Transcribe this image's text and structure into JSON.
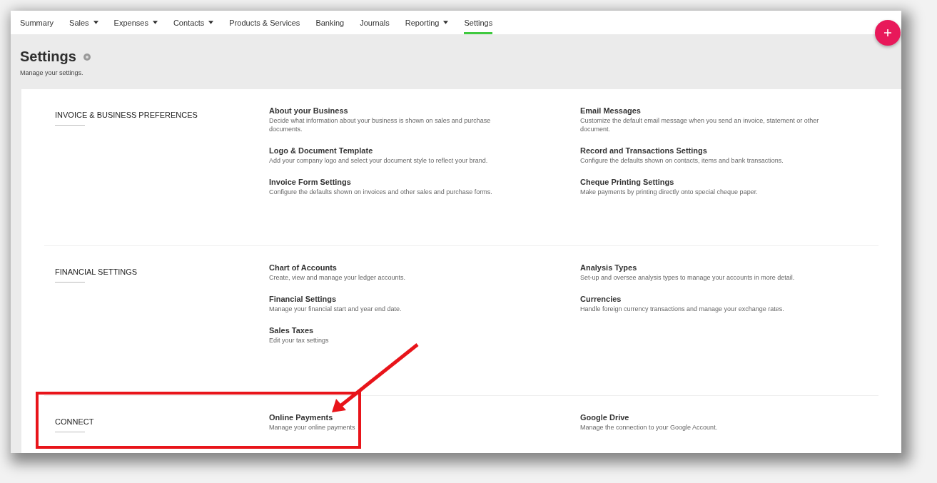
{
  "nav": [
    {
      "label": "Summary",
      "dropdown": false,
      "selected": false
    },
    {
      "label": "Sales",
      "dropdown": true,
      "selected": false
    },
    {
      "label": "Expenses",
      "dropdown": true,
      "selected": false
    },
    {
      "label": "Contacts",
      "dropdown": true,
      "selected": false
    },
    {
      "label": "Products & Services",
      "dropdown": false,
      "selected": false
    },
    {
      "label": "Banking",
      "dropdown": false,
      "selected": false
    },
    {
      "label": "Journals",
      "dropdown": false,
      "selected": false
    },
    {
      "label": "Reporting",
      "dropdown": true,
      "selected": false
    },
    {
      "label": "Settings",
      "dropdown": false,
      "selected": true
    }
  ],
  "header": {
    "title": "Settings",
    "subtitle": "Manage your settings."
  },
  "sections": [
    {
      "title": "INVOICE & BUSINESS PREFERENCES",
      "items": [
        {
          "title": "About your Business",
          "description": "Decide what information about your business is shown on sales and purchase documents."
        },
        {
          "title": "Email Messages",
          "description": "Customize the default email message when you send an invoice, statement or other document."
        },
        {
          "title": "Logo & Document Template",
          "description": "Add your company logo and select your document style to reflect your brand."
        },
        {
          "title": "Record and Transactions Settings",
          "description": "Configure the defaults shown on contacts, items and bank transactions."
        },
        {
          "title": "Invoice Form Settings",
          "description": "Configure the defaults shown on invoices and other sales and purchase forms."
        },
        {
          "title": "Cheque Printing Settings",
          "description": "Make payments by printing directly onto special cheque paper."
        }
      ]
    },
    {
      "title": "FINANCIAL SETTINGS",
      "items": [
        {
          "title": "Chart of Accounts",
          "description": "Create, view and manage your ledger accounts."
        },
        {
          "title": "Analysis Types",
          "description": "Set-up and oversee analysis types to manage your accounts in more detail."
        },
        {
          "title": "Financial Settings",
          "description": "Manage your financial start and year end date."
        },
        {
          "title": "Currencies",
          "description": "Handle foreign currency transactions and manage your exchange rates."
        },
        {
          "title": "Sales Taxes",
          "description": "Edit your tax settings"
        }
      ]
    },
    {
      "title": "CONNECT",
      "items": [
        {
          "title": "Online Payments",
          "description": "Manage your online payments"
        },
        {
          "title": "Google Drive",
          "description": "Manage the connection to your Google Account."
        }
      ]
    }
  ]
}
